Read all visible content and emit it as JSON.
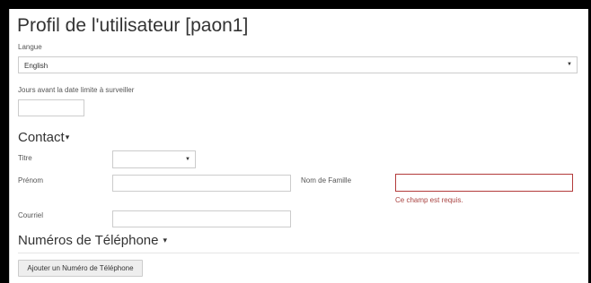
{
  "page": {
    "title": "Profil de l'utilisateur [paon1]"
  },
  "language": {
    "label": "Langue",
    "value": "English",
    "caret": "▼"
  },
  "deadline": {
    "label": "Jours avant la date limite à surveiller",
    "value": ""
  },
  "contact": {
    "heading": "Contact",
    "toggle": "▾",
    "title_label": "Titre",
    "title_value": "",
    "title_caret": "▼",
    "first_name_label": "Prénom",
    "first_name_value": "",
    "last_name_label": "Nom de Famille",
    "last_name_value": "",
    "last_name_error": "Ce champ est requis.",
    "email_label": "Courriel",
    "email_value": ""
  },
  "phones": {
    "heading": "Numéros de Téléphone",
    "toggle": "▾",
    "add_button": "Ajouter un Numéro de Téléphone"
  },
  "colors": {
    "error": "#a94442",
    "error_border": "#b33a3a"
  }
}
